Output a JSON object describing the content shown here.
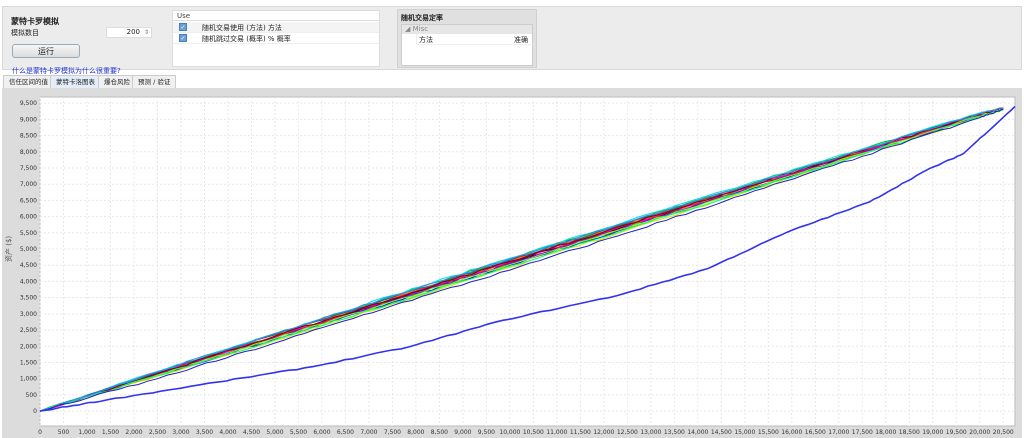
{
  "panel": {
    "title": "蒙特卡罗模拟",
    "count_label": "模拟数目",
    "count_value": "200",
    "run_label": "运行",
    "help_link": "什么是蒙特卡罗模拟为什么很重要?"
  },
  "options_table": {
    "header": "Use",
    "rows": [
      {
        "checked": true,
        "label": "随机交易使用 (方法) 方法"
      },
      {
        "checked": true,
        "label": "随机跳过交易 (概率) % 概率"
      }
    ]
  },
  "right_panel": {
    "title": "随机交易定率",
    "group": "Misc",
    "key": "方法",
    "value": "准确"
  },
  "tabs": [
    {
      "label": "信任区间的值",
      "selected": false
    },
    {
      "label": "蒙特卡洛图表",
      "selected": true
    },
    {
      "label": "爆仓风险",
      "selected": false
    },
    {
      "label": "预测 / 验证",
      "selected": false
    }
  ],
  "chart_data": {
    "type": "line",
    "ylabel": "资产 ($)",
    "xlim": [
      0,
      20750
    ],
    "ylim": [
      -460,
      9690
    ],
    "xticks": [
      0,
      500,
      1000,
      1500,
      2000,
      2500,
      3000,
      3500,
      4000,
      4500,
      5000,
      5500,
      6000,
      6500,
      7000,
      7500,
      8000,
      8500,
      9000,
      9500,
      10000,
      10500,
      11000,
      11500,
      12000,
      12500,
      13000,
      13500,
      14000,
      14500,
      15000,
      15500,
      16000,
      16500,
      17000,
      17500,
      18000,
      18500,
      19000,
      19500,
      20000,
      20500
    ],
    "yticks": [
      0,
      500,
      1000,
      1500,
      2000,
      2500,
      3000,
      3500,
      4000,
      4500,
      5000,
      5500,
      6000,
      6500,
      7000,
      7500,
      8000,
      8500,
      9000,
      9500
    ],
    "grid": true,
    "x": [
      0,
      2500,
      5000,
      7500,
      10000,
      12500,
      15000,
      17500,
      20000,
      20500
    ],
    "series": [
      {
        "color": "#ff0000",
        "values": [
          0,
          1180,
          2350,
          3500,
          4650,
          5790,
          6930,
          8050,
          9180,
          9340
        ]
      },
      {
        "color": "#00c000",
        "values": [
          0,
          1200,
          2380,
          3540,
          4700,
          5830,
          6950,
          8080,
          9190,
          9350
        ]
      },
      {
        "color": "#0000ff",
        "values": [
          0,
          1100,
          2220,
          3360,
          4500,
          5650,
          6790,
          7940,
          9090,
          9320
        ]
      },
      {
        "color": "#ff00ff",
        "values": [
          0,
          1160,
          2300,
          3430,
          4580,
          5720,
          6860,
          7990,
          9130,
          9330
        ]
      },
      {
        "color": "#00e0e0",
        "values": [
          0,
          1220,
          2400,
          3570,
          4720,
          5860,
          6980,
          8090,
          9200,
          9360
        ]
      },
      {
        "color": "#e0e000",
        "values": [
          0,
          1080,
          2180,
          3300,
          4430,
          5580,
          6740,
          7900,
          9060,
          9300
        ]
      },
      {
        "color": "#000000",
        "values": [
          0,
          1150,
          2290,
          3440,
          4590,
          5730,
          6870,
          8000,
          9140,
          9330
        ]
      },
      {
        "color": "#808000",
        "values": [
          0,
          1120,
          2250,
          3390,
          4530,
          5680,
          6820,
          7960,
          9100,
          9320
        ]
      },
      {
        "color": "#ff8000",
        "values": [
          0,
          1170,
          2320,
          3470,
          4610,
          5750,
          6890,
          8020,
          9150,
          9340
        ]
      },
      {
        "color": "#8000ff",
        "values": [
          0,
          1130,
          2270,
          3410,
          4550,
          5690,
          6830,
          7970,
          9110,
          9325
        ]
      },
      {
        "color": "#008080",
        "values": [
          0,
          1190,
          2360,
          3510,
          4660,
          5800,
          6920,
          8040,
          9170,
          9345
        ]
      },
      {
        "color": "#ff0080",
        "values": [
          0,
          1140,
          2290,
          3450,
          4600,
          5740,
          6880,
          8010,
          9140,
          9335
        ]
      },
      {
        "color": "#80ff00",
        "values": [
          0,
          1110,
          2240,
          3380,
          4520,
          5660,
          6800,
          7950,
          9100,
          9320
        ]
      },
      {
        "color": "#800000",
        "values": [
          0,
          1160,
          2310,
          3460,
          4620,
          5760,
          6900,
          8030,
          9150,
          9340
        ]
      },
      {
        "color": "#00ff80",
        "values": [
          0,
          1090,
          2200,
          3330,
          4470,
          5620,
          6770,
          7920,
          9070,
          9310
        ]
      },
      {
        "color": "#4080ff",
        "values": [
          0,
          1210,
          2390,
          3550,
          4690,
          5820,
          6940,
          8060,
          9180,
          9350
        ]
      },
      {
        "color": "#2020c0",
        "values": [
          0,
          1000,
          2100,
          3250,
          4350,
          5500,
          6680,
          7860,
          9050,
          9300
        ]
      }
    ],
    "worst_case": {
      "color": "#3333ee",
      "x": [
        0,
        1400,
        3800,
        5800,
        7850,
        9850,
        12300,
        14200,
        15900,
        17650,
        18850,
        19650,
        20750
      ],
      "values": [
        0,
        340,
        900,
        1370,
        1980,
        2800,
        3570,
        4390,
        5520,
        6450,
        7420,
        7940,
        9400
      ]
    }
  }
}
